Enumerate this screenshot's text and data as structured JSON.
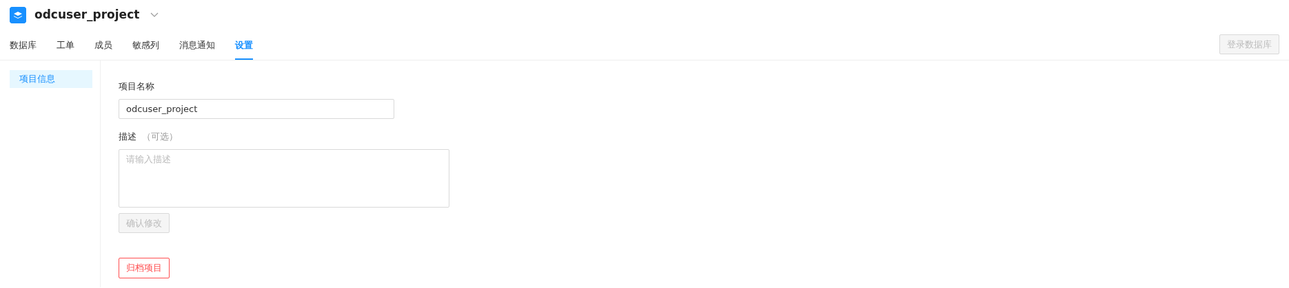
{
  "project": {
    "title": "odcuser_project"
  },
  "tabs": [
    {
      "label": "数据库",
      "selected": false
    },
    {
      "label": "工单",
      "selected": false
    },
    {
      "label": "成员",
      "selected": false
    },
    {
      "label": "敏感列",
      "selected": false
    },
    {
      "label": "消息通知",
      "selected": false
    },
    {
      "label": "设置",
      "selected": true
    }
  ],
  "login_button": {
    "label": "登录数据库",
    "disabled": true
  },
  "sidebar": {
    "items": [
      {
        "label": "项目信息",
        "selected": true
      }
    ]
  },
  "form": {
    "name_label": "项目名称",
    "name_value": "odcuser_project",
    "description_label": "描述",
    "description_optional": "（可选）",
    "description_placeholder": "请输入描述",
    "confirm_button": {
      "label": "确认修改",
      "disabled": true
    },
    "archive_button": {
      "label": "归档项目",
      "disabled": false
    }
  }
}
